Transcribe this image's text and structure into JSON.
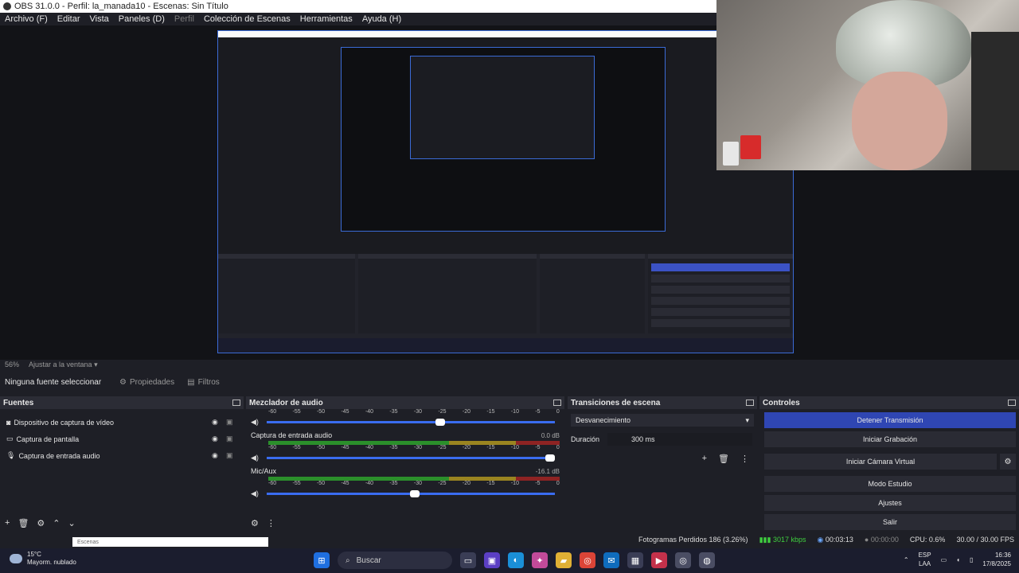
{
  "window": {
    "title": "OBS 31.0.0 - Perfil: la_manada10 - Escenas: Sin Título"
  },
  "menu": {
    "items": [
      "Archivo (F)",
      "Editar",
      "Vista",
      "Paneles (D)",
      "Perfil",
      "Colección de Escenas",
      "Herramientas",
      "Ayuda (H)"
    ]
  },
  "preview": {
    "zoom": "56%",
    "fit_label": "Ajustar a la ventana"
  },
  "properties_bar": {
    "no_source": "Ninguna fuente seleccionar",
    "properties_label": "Propiedades",
    "filters_label": "Filtros"
  },
  "sources": {
    "title": "Fuentes",
    "items": [
      {
        "label": "Dispositivo de captura de vídeo",
        "icon": "camera-icon"
      },
      {
        "label": "Captura de pantalla",
        "icon": "monitor-icon"
      },
      {
        "label": "Captura de entrada audio",
        "icon": "microphone-icon"
      }
    ]
  },
  "mixer": {
    "title": "Mezclador de audio",
    "tick_labels": [
      "-60",
      "-55",
      "-50",
      "-45",
      "-40",
      "-35",
      "-30",
      "-25",
      "-20",
      "-15",
      "-10",
      "-5",
      "0"
    ],
    "channels": [
      {
        "name": "",
        "db": "",
        "volume_fraction": 0.62
      },
      {
        "name": "Captura de entrada audio",
        "db": "0.0 dB",
        "volume_fraction": 1.0
      },
      {
        "name": "Mic/Aux",
        "db": "-16.1 dB",
        "volume_fraction": 0.53
      }
    ]
  },
  "transitions": {
    "title": "Transiciones de escena",
    "selected": "Desvanecimiento",
    "duration_label": "Duración",
    "duration_value": "300 ms"
  },
  "controls": {
    "title": "Controles",
    "stop_stream": "Detener Transmisión",
    "start_recording": "Iniciar Grabación",
    "start_virtual_cam": "Iniciar Cámara Virtual",
    "studio_mode": "Modo Estudio",
    "settings": "Ajustes",
    "exit": "Salir"
  },
  "statusbar": {
    "dropped_frames": "Fotogramas Perdidos 186 (3.26%)",
    "bitrate": "3017 kbps",
    "stream_time": "00:03:13",
    "rec_time": "00:00:00",
    "cpu": "CPU: 0.6%",
    "fps": "30.00 / 30.00 FPS"
  },
  "scenes_peek": "Escenas",
  "taskbar": {
    "temp": "15°C",
    "weather": "Mayorm. nublado",
    "search_placeholder": "Buscar",
    "lang_top": "ESP",
    "lang_bottom": "LAA",
    "time": "16:36",
    "date": "17/8/2025"
  },
  "colors": {
    "accent": "#3b6bd6",
    "active_button": "#2f46b3",
    "meter_green": "#2b8f2b",
    "meter_yellow": "#9a8420",
    "meter_red": "#8e2323",
    "background": "#1e1f26"
  }
}
